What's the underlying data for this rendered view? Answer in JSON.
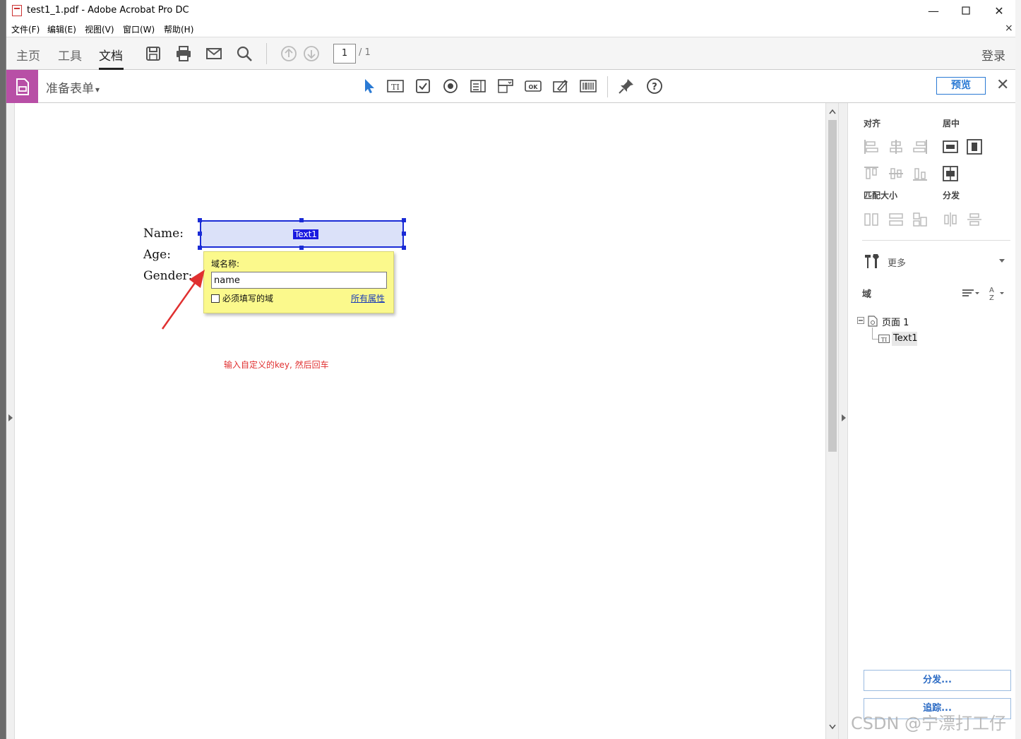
{
  "window": {
    "title": "test1_1.pdf - Adobe Acrobat Pro DC",
    "min_glyph": "—",
    "max_glyph": "☐",
    "close_glyph": "✕"
  },
  "menu": {
    "items": [
      "文件(F)",
      "编辑(E)",
      "视图(V)",
      "窗口(W)",
      "帮助(H)"
    ],
    "close_glyph": "×"
  },
  "nav": {
    "tabs": [
      "主页",
      "工具",
      "文档"
    ],
    "active_tab": "文档",
    "page_current": "1",
    "page_total": "/ 1",
    "login": "登录"
  },
  "form_toolbar": {
    "title": "准备表单",
    "dropdown_glyph": "▾",
    "preview": "预览",
    "close_glyph": "✕"
  },
  "document": {
    "labels": [
      "Name:",
      "Age:",
      "Gender:"
    ],
    "field_tag": "Text1",
    "popup": {
      "label": "域名称:",
      "value": "name",
      "required_label": "必须填写的域",
      "all_props_link": "所有属性"
    },
    "annotation": "输入自定义的key, 然后回车"
  },
  "right_panel": {
    "align_heading": "对齐",
    "center_heading": "居中",
    "match_size_heading": "匹配大小",
    "distribute_heading": "分发",
    "more_label": "更多",
    "fields_heading": "域",
    "tree_page": "页面 1",
    "tree_field": "Text1",
    "distribute_button": "分发...",
    "track_button": "追踪..."
  },
  "watermark": "CSDN @宁漂打工仔",
  "colors": {
    "accent_blue": "#2a7ad4",
    "form_purple": "#b84fa6",
    "field_fill": "#dbe1f9",
    "field_border": "#1a2bd6",
    "popup_yellow": "#fbf98c",
    "annotation_red": "#e03030"
  }
}
